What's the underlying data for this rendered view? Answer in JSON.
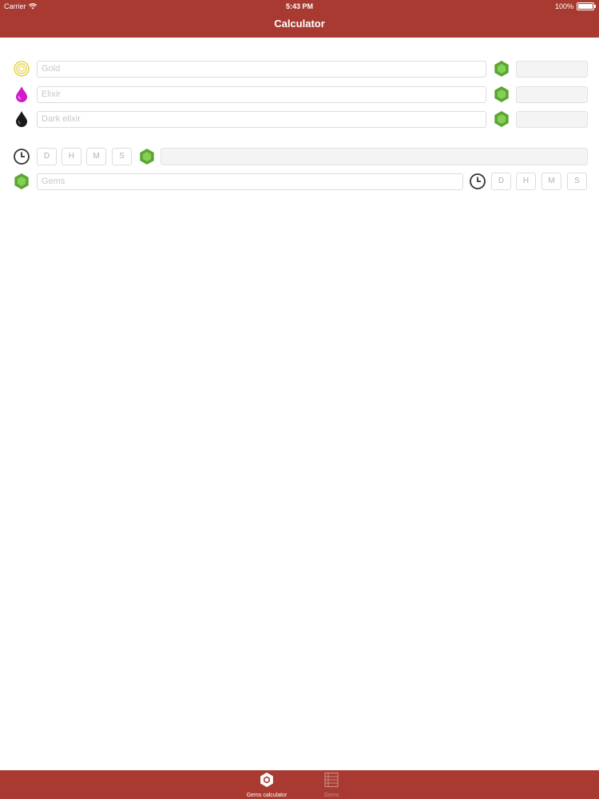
{
  "status_bar": {
    "carrier": "Carrier",
    "time": "5:43 PM",
    "battery": "100%"
  },
  "nav": {
    "title": "Calculator"
  },
  "resources": [
    {
      "name": "gold",
      "placeholder": "Gold",
      "icon": "gold-coins-icon",
      "color": "#e8d44d"
    },
    {
      "name": "elixir",
      "placeholder": "Elixir",
      "icon": "elixir-drop-icon",
      "color": "#d11ac8"
    },
    {
      "name": "dark-elixir",
      "placeholder": "Dark elixir",
      "icon": "dark-elixir-drop-icon",
      "color": "#1a1a1a"
    }
  ],
  "time_to_gems": {
    "segments": [
      "D",
      "H",
      "M",
      "S"
    ]
  },
  "gems_to_time": {
    "placeholder": "Gems",
    "segments": [
      "D",
      "H",
      "M",
      "S"
    ]
  },
  "tabbar": {
    "tabs": [
      {
        "label": "Gems calculator",
        "active": true,
        "icon": "gem-tab-icon"
      },
      {
        "label": "Gems",
        "active": false,
        "icon": "list-tab-icon"
      }
    ]
  },
  "colors": {
    "primary": "#a83a31",
    "gem": "#5aa632",
    "clock": "#333333"
  }
}
